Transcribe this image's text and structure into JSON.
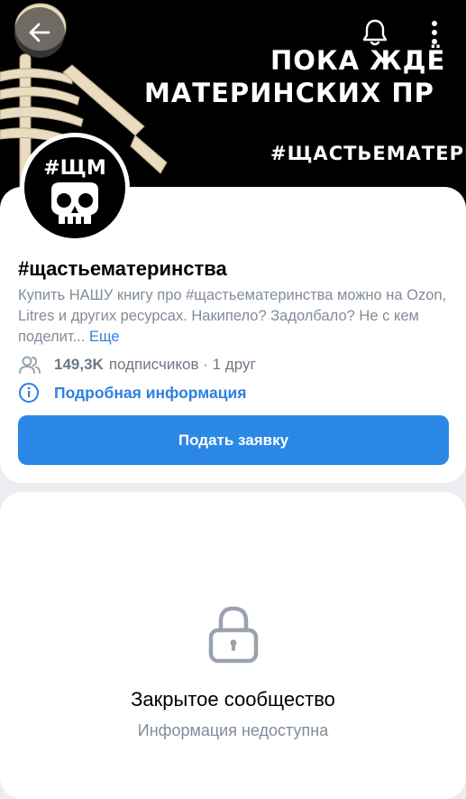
{
  "cover": {
    "line1": "ПОКА ЖДЁ",
    "line2": "МАТЕРИНСКИХ ПР",
    "line3": "#ЩАСТЬЕМАТЕРИН"
  },
  "avatar": {
    "tag": "#ЩМ"
  },
  "header": {
    "back_icon": "arrow-left-icon",
    "bell_icon": "bell-icon",
    "more_icon": "more-vertical-icon"
  },
  "group": {
    "name": "#щастьематеринства",
    "description": "Купить НАШУ книгу про #щастьематеринства можно на Ozon, Litres и других ресурсах. Накипело? Задолбало? Не с кем поделит...",
    "more_label": "Еще",
    "followers_count": "149,3K",
    "followers_rest": "подписчиков · 1 друг",
    "info_link": "Подробная информация",
    "apply_label": "Подать заявку"
  },
  "closed": {
    "title": "Закрытое сообщество",
    "subtitle": "Информация недоступна"
  },
  "colors": {
    "accent": "#2b87e6",
    "link": "#2d81e0",
    "secondary_text": "#818c99",
    "background": "#ebedf0"
  }
}
